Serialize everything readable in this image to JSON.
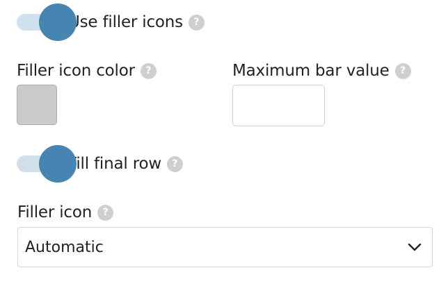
{
  "settings": {
    "use_filler_icons": {
      "label": "Use filler icons",
      "enabled": true,
      "help_icon": "question-circle-icon"
    },
    "filler_icon_color": {
      "label": "Filler icon color",
      "color": "#cbcbcb",
      "help_icon": "question-circle-icon"
    },
    "maximum_bar_value": {
      "label": "Maximum bar value",
      "value": "",
      "help_icon": "question-circle-icon"
    },
    "fill_final_row": {
      "label": "Fill final row",
      "enabled": true,
      "help_icon": "question-circle-icon"
    },
    "filler_icon": {
      "label": "Filler icon",
      "selected": "Automatic",
      "help_icon": "question-circle-icon",
      "dropdown_icon": "chevron-down-icon"
    }
  },
  "help_glyph": "?",
  "colors": {
    "toggle_knob": "#4685b2",
    "toggle_track": "#cfe0ec",
    "help_icon": "#cfcfcf",
    "text": "#222222"
  }
}
